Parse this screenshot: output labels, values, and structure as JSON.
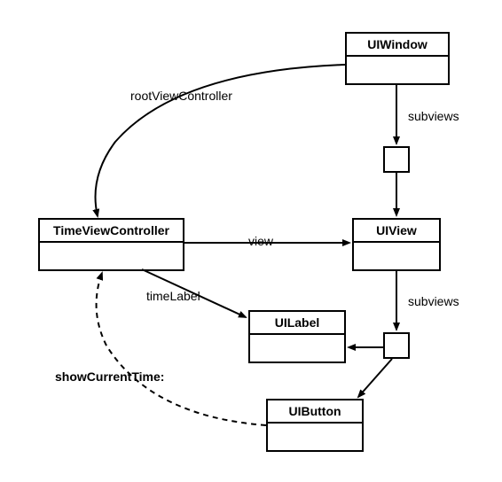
{
  "classes": {
    "uiwindow": "UIWindow",
    "timeviewcontroller": "TimeViewController",
    "uiview": "UIView",
    "uilabel": "UILabel",
    "uibutton": "UIButton"
  },
  "labels": {
    "rootViewController": "rootViewController",
    "subviews1": "subviews",
    "view": "view",
    "timeLabel": "timeLabel",
    "subviews2": "subviews",
    "showCurrentTime": "showCurrentTime:"
  }
}
